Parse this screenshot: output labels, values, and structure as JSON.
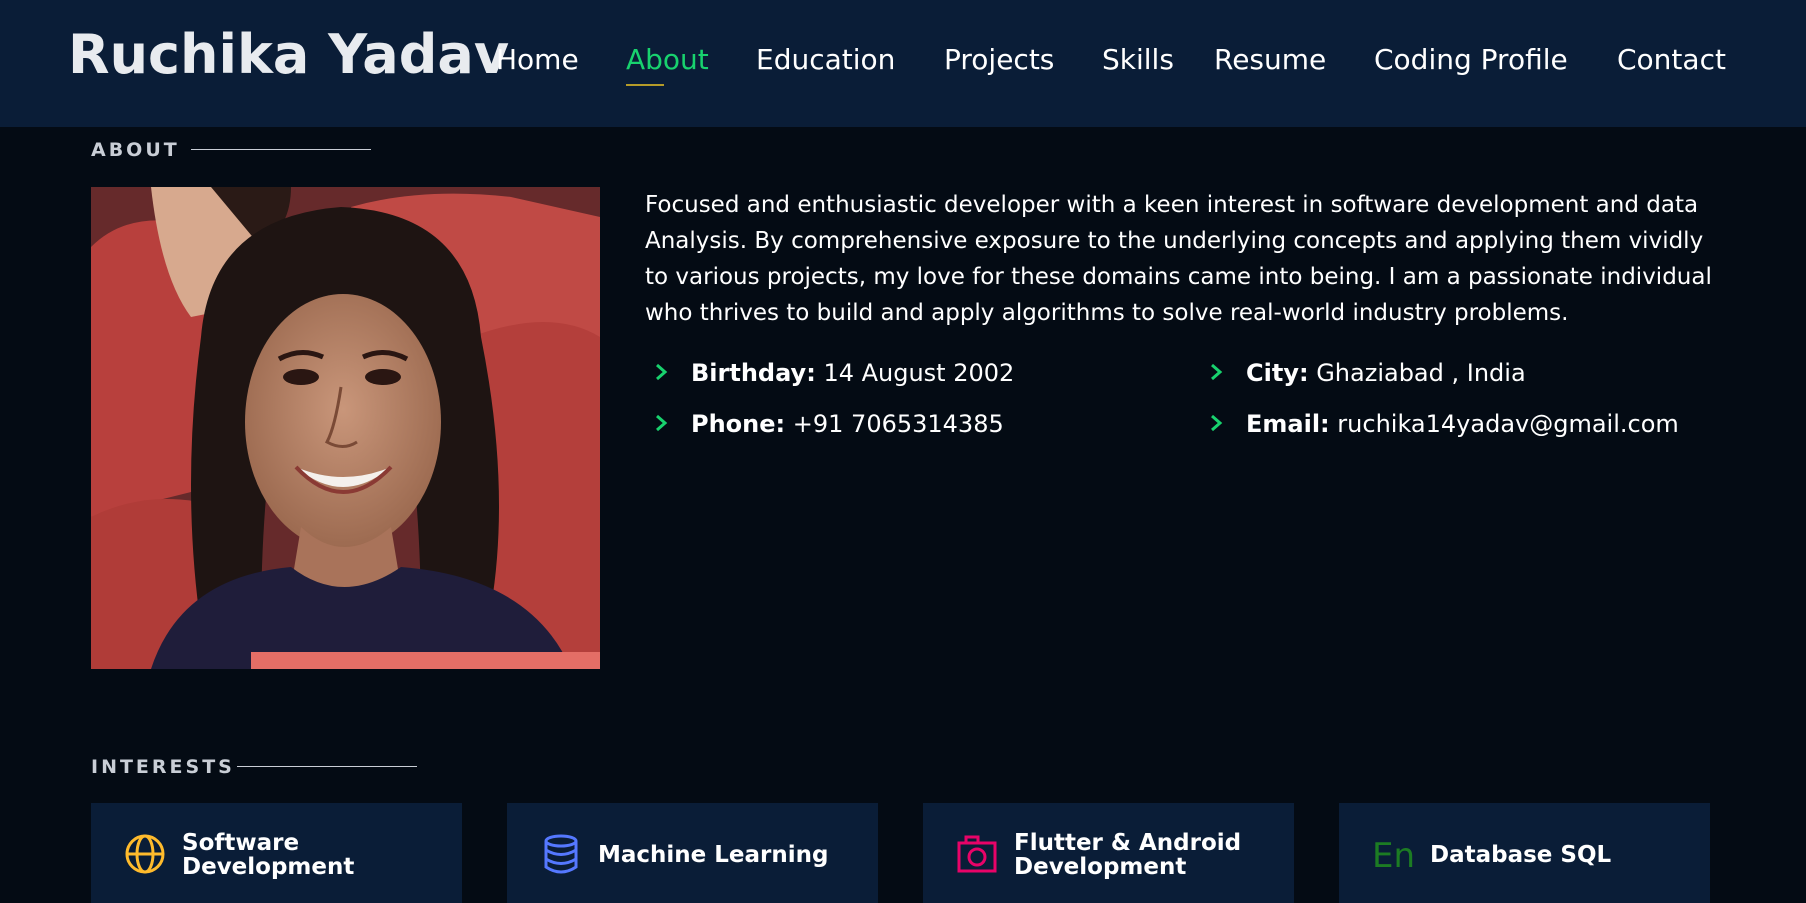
{
  "header": {
    "brand": "Ruchika Yadav",
    "nav": [
      {
        "label": "Home"
      },
      {
        "label": "About",
        "active": true
      },
      {
        "label": "Education"
      },
      {
        "label": "Projects"
      },
      {
        "label": "Skills"
      },
      {
        "label": "Resume"
      },
      {
        "label": "Coding Profile"
      },
      {
        "label": "Contact"
      }
    ]
  },
  "about": {
    "heading": "ABOUT",
    "description": "Focused and enthusiastic developer with a keen interest in software development and data Analysis. By comprehensive exposure to the underlying concepts and applying them vividly to various projects, my love for these domains came into being. I am a passionate individual who thrives to build and apply algorithms to solve real-world industry problems.",
    "info": {
      "birthday": {
        "label": "Birthday:",
        "value": "14 August 2002"
      },
      "phone": {
        "label": "Phone:",
        "value": "+91 7065314385"
      },
      "city": {
        "label": "City:",
        "value": "Ghaziabad , India"
      },
      "email": {
        "label": "Email:",
        "value": "ruchika14yadav@gmail.com"
      }
    }
  },
  "interests": {
    "heading": "INTERESTS",
    "cards": [
      {
        "line1": "Software",
        "line2": "Development",
        "icon": "globe-icon",
        "color": "#ffbb2c"
      },
      {
        "line1": "Machine Learning",
        "line2": "",
        "icon": "database-icon",
        "color": "#5578ff"
      },
      {
        "line1": "Flutter & Android",
        "line2": "Development",
        "icon": "camera-icon",
        "color": "#e80368"
      },
      {
        "line1": "Database SQL",
        "line2": "",
        "icon": "en-icon",
        "color": "#1c7c23",
        "icon_text": "En"
      }
    ]
  },
  "colors": {
    "header_bg": "#0a1d37",
    "page_bg": "#040b14",
    "accent": "#18d26e",
    "underline": "#b59b29"
  }
}
